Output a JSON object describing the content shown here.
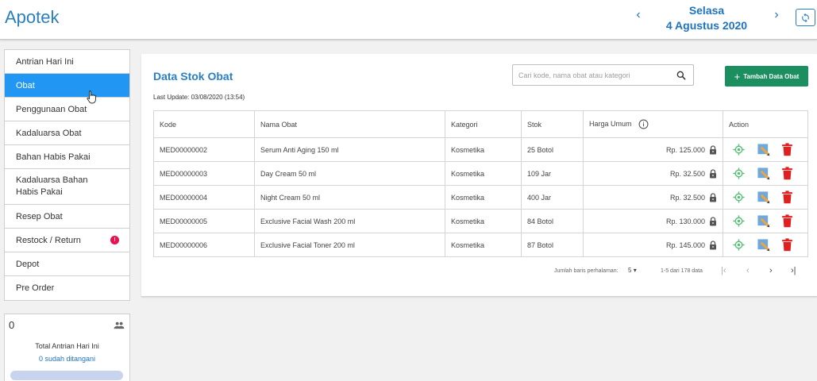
{
  "header": {
    "app_title": "Apotek",
    "day": "Selasa",
    "date": "4 Agustus 2020",
    "prev_label": "‹",
    "next_label": "›"
  },
  "sidebar": {
    "items": [
      {
        "label": "Antrian Hari Ini"
      },
      {
        "label": "Obat"
      },
      {
        "label": "Penggunaan Obat"
      },
      {
        "label": "Kadaluarsa Obat"
      },
      {
        "label": "Bahan Habis Pakai"
      },
      {
        "label": "Kadaluarsa Bahan Habis Pakai"
      },
      {
        "label": "Resep Obat"
      },
      {
        "label": "Restock / Return",
        "badge": "!"
      },
      {
        "label": "Depot"
      },
      {
        "label": "Pre Order"
      }
    ],
    "active_index": 1
  },
  "queue_card": {
    "count": "0",
    "label": "Total Antrian Hari Ini",
    "handled": "0 sudah ditangani",
    "icon": "people-icon"
  },
  "main": {
    "title": "Data Stok Obat",
    "last_update": "Last Update: 03/08/2020 (13:54)",
    "search_placeholder": "Cari kode, nama obat atau kategori",
    "add_button": "Tambah Data Obat",
    "columns": [
      "Kode",
      "Nama Obat",
      "Kategori",
      "Stok",
      "Harga Umum",
      "Action"
    ],
    "rows": [
      {
        "kode": "MED00000002",
        "nama": "Serum Anti Aging 150 ml",
        "kategori": "Kosmetika",
        "stok": "25 Botol",
        "harga": "Rp. 125.000"
      },
      {
        "kode": "MED00000003",
        "nama": "Day Cream 50 ml",
        "kategori": "Kosmetika",
        "stok": "109 Jar",
        "harga": "Rp. 32.500"
      },
      {
        "kode": "MED00000004",
        "nama": "Night Cream 50 ml",
        "kategori": "Kosmetika",
        "stok": "400 Jar",
        "harga": "Rp. 32.500"
      },
      {
        "kode": "MED00000005",
        "nama": "Exclusive Facial Wash 200 ml",
        "kategori": "Kosmetika",
        "stok": "84 Botol",
        "harga": "Rp. 130.000"
      },
      {
        "kode": "MED00000006",
        "nama": "Exclusive Facial Toner 200 ml",
        "kategori": "Kosmetika",
        "stok": "87 Botol",
        "harga": "Rp. 145.000"
      }
    ],
    "pagination": {
      "rows_label": "Jumlah baris perhalaman:",
      "rows_value": "5",
      "range": "1-5 dari 178 data",
      "first": "|‹",
      "prev": "‹",
      "next": "›",
      "last": "›|"
    }
  },
  "colors": {
    "accent": "#2196f3",
    "title_blue": "#2a7fc1",
    "add_green": "#1b8f5f",
    "badge_red": "#e8124f",
    "delete_red": "#e02020",
    "view_green": "#5cbf7a"
  }
}
